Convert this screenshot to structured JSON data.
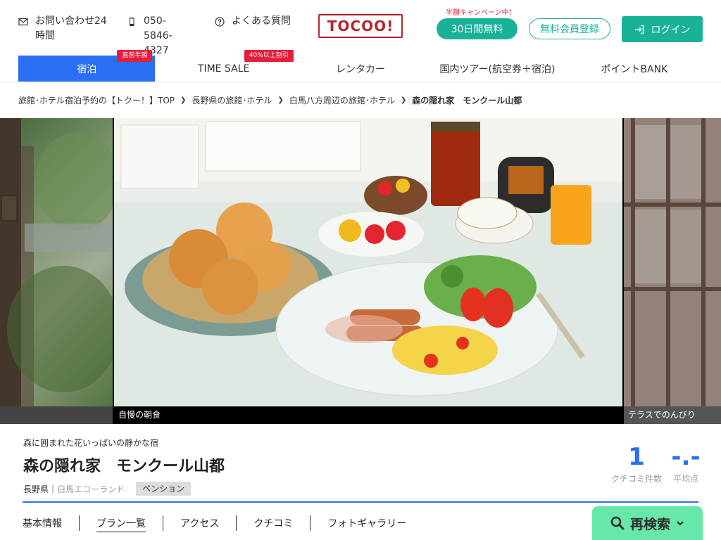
{
  "header": {
    "contact": {
      "label": "お問い合わせ24時間",
      "icon": "envelope-icon"
    },
    "phone": {
      "label": "050-5846-4327",
      "icon": "mobile-phone-icon"
    },
    "faq": {
      "label": "よくある質問",
      "icon": "question-circle-icon"
    },
    "logo_text": "TOCOO!",
    "campaign_note": "半額キャンペーン中！",
    "trial_button": "30日間無料",
    "register_button": "無料会員登録",
    "login_button": "ログイン",
    "colors": {
      "brand": "#b3262f",
      "accent": "#1ab199",
      "primary": "#2a6ff5",
      "badge": "#e51e3c"
    }
  },
  "nav": {
    "items": [
      {
        "label": "宿泊",
        "badge": "直前半額",
        "active": true
      },
      {
        "label": "TIME SALE",
        "badge": "40%以上割引",
        "active": false
      },
      {
        "label": "レンタカー",
        "badge": "",
        "active": false
      },
      {
        "label": "国内ツアー(航空券＋宿泊)",
        "badge": "",
        "active": false
      },
      {
        "label": "ポイントBANK",
        "badge": "",
        "active": false
      }
    ]
  },
  "breadcrumb": [
    "旅館･ホテル宿泊予約の【トクー！】TOP",
    "長野県の旅館･ホテル",
    "白馬八方周辺の旅館･ホテル",
    "森の隠れ家　モンクール山都"
  ],
  "gallery": {
    "captions": [
      "",
      "自慢の朝食",
      "テラスでのんびり"
    ]
  },
  "hotel": {
    "tagline": "森に囲まれた花いっぱいの静かな宿",
    "name": "森の隠れ家　モンクール山都",
    "prefecture": "長野県",
    "area": "白馬エコーランド",
    "type": "ペンション",
    "review_count": "1",
    "review_count_label": "クチコミ件数",
    "average": "-.-",
    "average_label": "平均点"
  },
  "tabs": [
    "基本情報",
    "プラン一覧",
    "アクセス",
    "クチコミ",
    "フォトギャラリー"
  ],
  "active_tab": "プラン一覧",
  "research_button": "再検索"
}
